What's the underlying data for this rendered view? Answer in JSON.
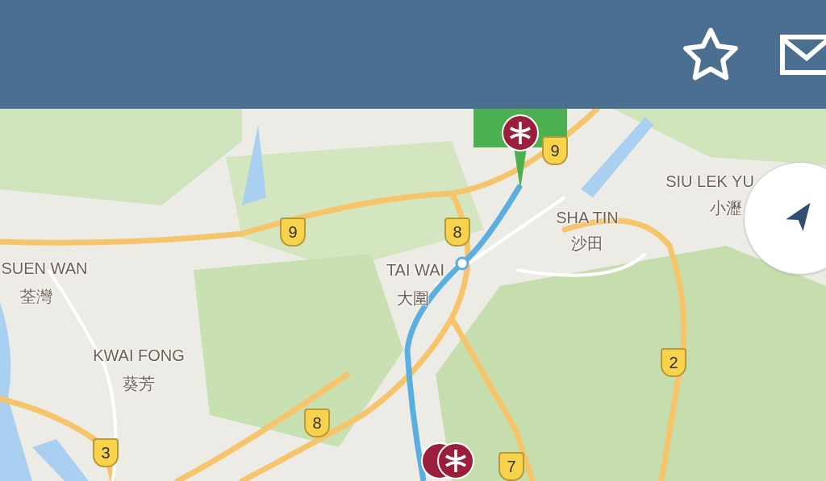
{
  "map": {
    "place_labels": [
      {
        "name": "SIU LEK YU"
      },
      {
        "name": "小瀝"
      },
      {
        "name": "SHA TIN"
      },
      {
        "name": "沙田"
      },
      {
        "name": "TAI WAI"
      },
      {
        "name": "大圍"
      },
      {
        "name": "SUEN WAN"
      },
      {
        "name": "荃灣"
      },
      {
        "name": "KWAI FONG"
      },
      {
        "name": "葵芳"
      }
    ],
    "route_shields": [
      {
        "number": "9"
      },
      {
        "number": "8"
      },
      {
        "number": "9"
      },
      {
        "number": "2"
      },
      {
        "number": "8"
      },
      {
        "number": "3"
      },
      {
        "number": "7"
      }
    ]
  }
}
